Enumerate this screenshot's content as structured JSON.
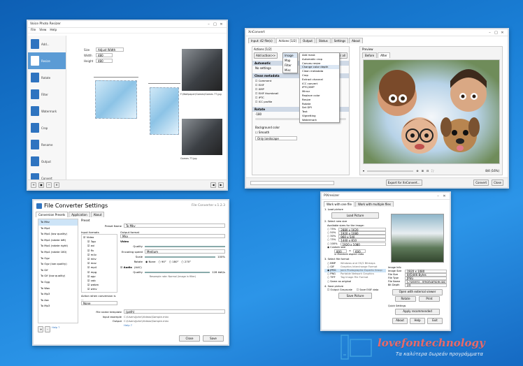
{
  "desktop": {
    "watermark_brand": "lovefontechnology",
    "watermark_tagline": "Τα καλύτερα δωρεάν προγράμματα"
  },
  "win1": {
    "title": "Voice Photo Resizer",
    "menu": [
      "File",
      "View",
      "Help"
    ],
    "controls": {
      "size_label": "Size",
      "size_value": "Adjust Width",
      "width_label": "Width",
      "width_value": "480",
      "height_label": "Height",
      "height_value": "480"
    },
    "sidebar": [
      {
        "label": "Add...",
        "icon": "add-icon"
      },
      {
        "label": "Resize",
        "icon": "resize-icon"
      },
      {
        "label": "Rotate",
        "icon": "rotate-icon"
      },
      {
        "label": "Filter",
        "icon": "filter-icon"
      },
      {
        "label": "Watermark",
        "icon": "watermark-icon"
      },
      {
        "label": "Crop",
        "icon": "crop-icon"
      },
      {
        "label": "Rename",
        "icon": "rename-icon"
      },
      {
        "label": "Output",
        "icon": "output-icon"
      },
      {
        "label": "Convert",
        "icon": "convert-icon"
      }
    ],
    "thumbs": [
      {
        "caption": "F:\\Wallpaper\\Games\\Games 77.jpg"
      },
      {
        "caption": "Games 77.jpg"
      }
    ]
  },
  "win2": {
    "title": "XnConvert",
    "tabs": [
      "Input: 42 file(s)",
      "Actions [1/2]",
      "Output",
      "Status",
      "Settings",
      "About"
    ],
    "actions_label": "Actions [1/2]",
    "add_action": "Add action>>",
    "clear_all": "Clear all",
    "submenu_1": [
      "Image",
      "Map",
      "Filter",
      "Misc"
    ],
    "submenu_2": [
      "Add mask",
      "Automatic crop",
      "Canvas resize",
      "Change color depth",
      "Clean metadata",
      "Crop",
      "Extract channel",
      "ICC convert",
      "IPTC/XMP",
      "Mirror",
      "Replace color",
      "Resize",
      "Rotate",
      "Set DPI",
      "Text",
      "Vignetting",
      "Watermark"
    ],
    "sections": [
      {
        "title": "Automatic",
        "items": [
          "No settings"
        ]
      },
      {
        "title": "Clean metadata",
        "items": [
          "Comment",
          "EXIF",
          "XMP",
          "EXIF thumbnail",
          "IPTC",
          "ICC profile"
        ]
      },
      {
        "title": "Rotate",
        "items": [
          "-180"
        ]
      }
    ],
    "background_label": "Background color",
    "smooth_label": "Smooth",
    "only_landscape": "Only landscape",
    "preview_label": "Preview",
    "preview_tabs": [
      "Before",
      "After"
    ],
    "status_zoom": "8/4 (16%)",
    "export_btn": "Export for XnConvert...",
    "convert_btn": "Convert",
    "close_btn": "Close"
  },
  "win3": {
    "title": "File Converter Settings",
    "version": "File Converter v.1.2.3",
    "tabs": [
      "Conversion Presets",
      "Application",
      "About"
    ],
    "presets": [
      "To Mkv",
      "To Mp4",
      "To Mp4 (low quality)",
      "To Mp4 (rotate left)",
      "To Mp4 (rotate right)",
      "To Mp4 (rotate 180)",
      "To Ogv",
      "To Ogv (low quality)",
      "To Gif",
      "To Gif (low quality)",
      "To Ogg",
      "To Wav",
      "To Mp3",
      "To Aac",
      "To Mp3"
    ],
    "preset_section": "Preset",
    "preset_name_label": "Preset Name",
    "preset_name_value": "To Mkv",
    "input_formats_label": "Input formats",
    "video_group": "Video",
    "formats": [
      "3gp",
      "avi",
      "flv",
      "m4v",
      "mkv",
      "mov",
      "mp4",
      "mpg",
      "ogv",
      "vob",
      "webm",
      "wmv"
    ],
    "output_format_label": "Output format",
    "output_format_value": "Mkv",
    "video_label": "Video",
    "quality_label": "Quality",
    "encoding_speed_label": "Encoding speed",
    "encoding_speed_value": "Medium",
    "scale_label": "Scale",
    "scale_value": "100%",
    "rotate_label": "Rotate",
    "rotate_options": [
      "None",
      "90°",
      "180°",
      "270°"
    ],
    "audio_label": "Audio",
    "audio_format": "(AAC)",
    "audio_quality_value": "128 kbit/s",
    "resample_note": "Resample rate: Normal (image in filter)",
    "file_name_template_label": "File name template",
    "file_name_template_value": "(path)",
    "input_example_label": "Input example",
    "input_example_value": "C:\\Users\\John\\Videos\\Sample.mkv",
    "output_label": "Output",
    "output_value": "C:\\Users\\John\\Videos\\Sample.mkv",
    "help": "Help ?",
    "actions_when_label": "Action when conversion is ...",
    "actions_when_value": "None",
    "add_btn": "+",
    "remove_btn": "-",
    "close_btn": "Close",
    "save_btn": "Save"
  },
  "win4": {
    "title": "PIXresizer",
    "tabs": [
      "Work with one file",
      "Work with multiple files"
    ],
    "step1": "1. Load picture",
    "load_btn": "Load Picture",
    "step2": "2. Select new size",
    "available_sizes": "Available sizes for the image:",
    "sizes": [
      {
        "pct": "75%",
        "dims": "2880 x 1620"
      },
      {
        "pct": "50%",
        "dims": "1920 x 1080"
      },
      {
        "pct": "30%",
        "dims": "960 x 540"
      },
      {
        "pct": "75%",
        "dims": "1440 x 810"
      },
      {
        "pct": "100%",
        "dims": "1920 x 1080"
      }
    ],
    "custom_size": "Custom size",
    "custom_w": "800",
    "custom_h": "600",
    "maintain_aspect": "Maintain aspect ratio",
    "step3": "3. Select file format",
    "formats": [
      {
        "ext": "BMP",
        "desc": "Windows and OS/2 Bitmaps"
      },
      {
        "ext": "GIF",
        "desc": "Graphics Interchange Format"
      },
      {
        "ext": "JPEG",
        "desc": "Joint Photographic Experts Group"
      },
      {
        "ext": "PNG",
        "desc": "Portable Network Graphics"
      },
      {
        "ext": "TIFF",
        "desc": "Tag Image File Format"
      }
    ],
    "same_as_original": "Same as original",
    "step4": "4. Save picture",
    "output_grayscale": "Output Grayscale",
    "save_exif": "Save EXIF data",
    "save_btn": "Save Picture",
    "image_info_label": "Image Info",
    "info": [
      {
        "k": "Image Size",
        "v": "1920 x 1080"
      },
      {
        "k": "File Size",
        "v": "845446 Bytes"
      },
      {
        "k": "File Type",
        "v": "JPEG"
      },
      {
        "k": "File Name",
        "v": "C:\\Users\\...\\Img\\Sample.jpg"
      },
      {
        "k": "Bit Depth",
        "v": "24"
      }
    ],
    "open_editor_btn": "Open with external viewer",
    "rotate_btn": "Rotate",
    "print_btn": "Print",
    "quick_settings": "Quick Settings",
    "apply_btn": "Apply recommended",
    "about_btn": "About",
    "help_btn": "Help",
    "exit_btn": "Exit"
  }
}
